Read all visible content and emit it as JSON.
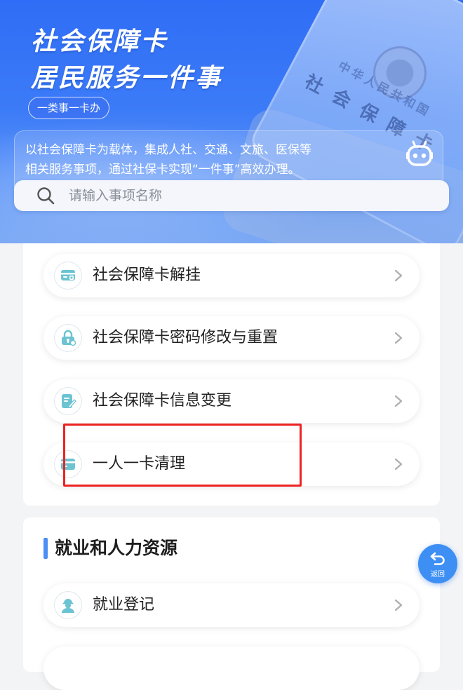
{
  "hero": {
    "title_line1": "社会保障卡",
    "title_line2": "居民服务一件事",
    "tag": "一类事一卡办",
    "desc_line1": "以社会保障卡为载体，集成人社、交通、文旅、医保等",
    "desc_line2": "相关服务事项，通过社保卡实现“一件事”高效办理。",
    "card_country": "中华人民共和国",
    "card_name": "社会保障卡"
  },
  "search": {
    "placeholder": "请输入事项名称"
  },
  "card_services": [
    {
      "label": "社会保障卡解挂",
      "icon": "card-unlock-icon"
    },
    {
      "label": "社会保障卡密码修改与重置",
      "icon": "lock-icon"
    },
    {
      "label": "社会保障卡信息变更",
      "icon": "edit-document-icon"
    },
    {
      "label": "一人一卡清理",
      "icon": "card-icon"
    }
  ],
  "employment": {
    "title": "就业和人力资源",
    "items": [
      {
        "label": "就业登记",
        "icon": "worker-avatar-icon"
      }
    ]
  },
  "back_button": {
    "label": "返回"
  },
  "colors": {
    "hero_blue": "#2f6df6",
    "icon_teal": "#5fb9c8",
    "accent_blue": "#4b8ef5",
    "highlight_red": "#ee2222"
  }
}
